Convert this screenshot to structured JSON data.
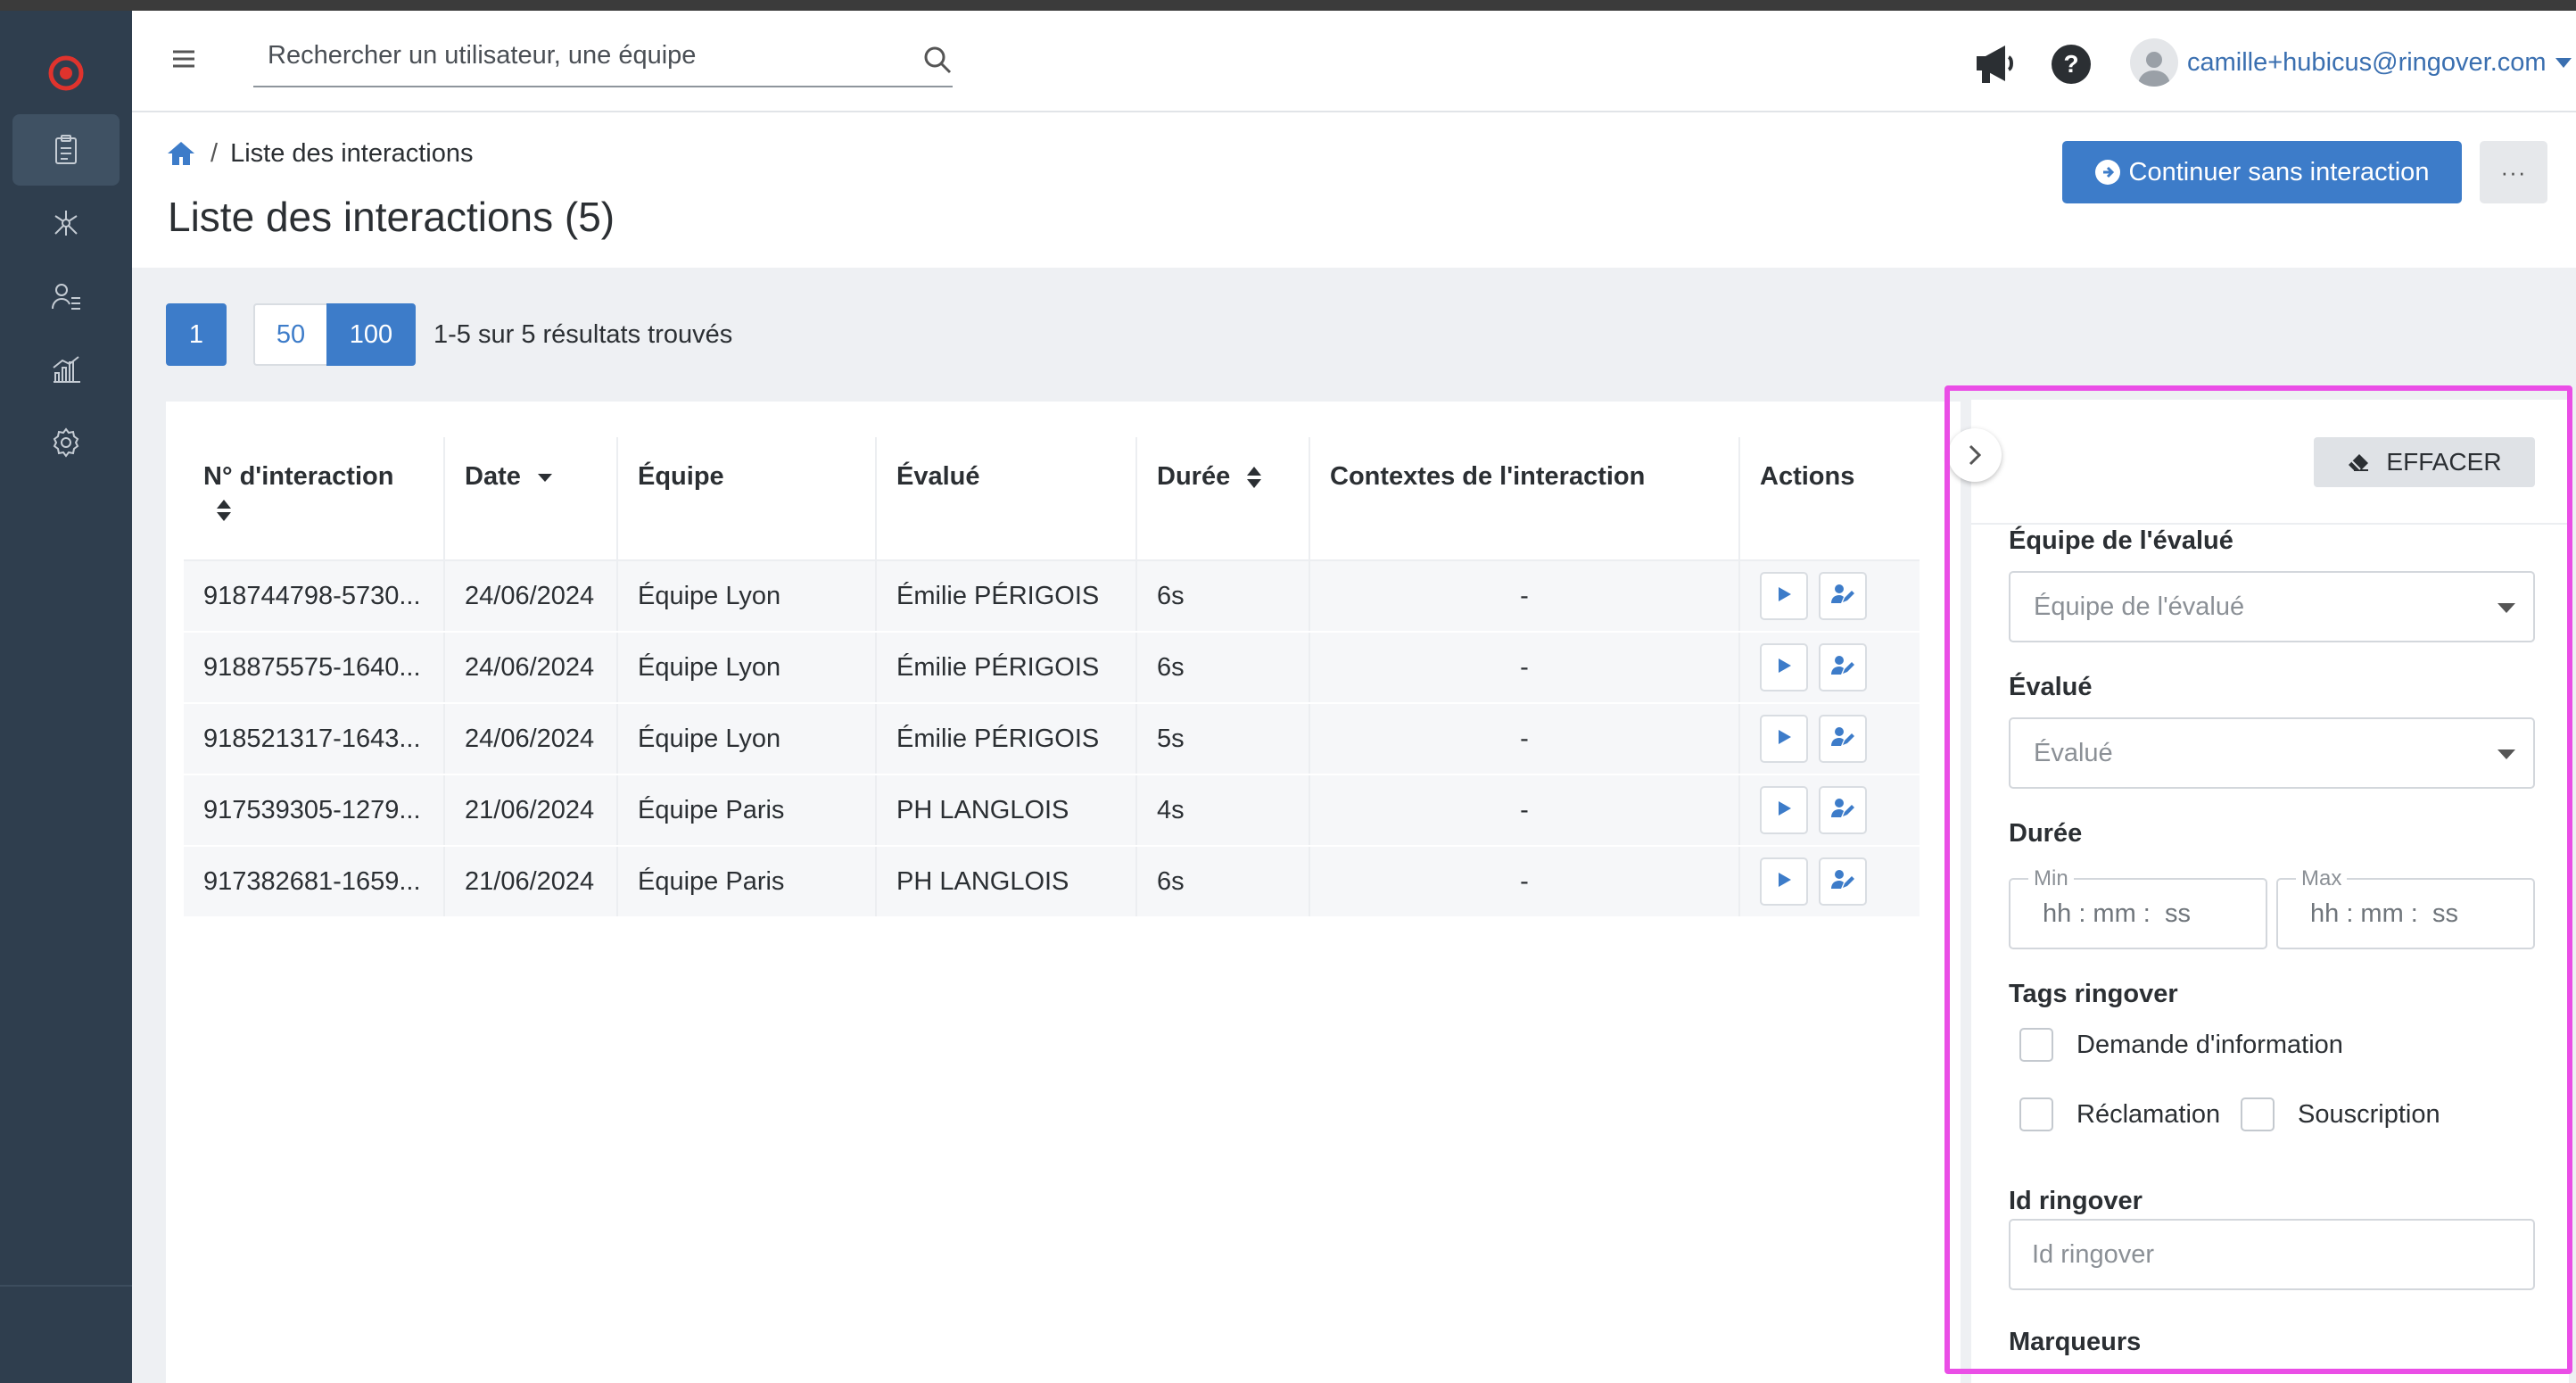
{
  "header": {
    "search_placeholder": "Rechercher un utilisateur, une équipe",
    "user_email": "camille+hubicus@ringover.com"
  },
  "breadcrumb": {
    "current": "Liste des interactions"
  },
  "page": {
    "title": "Liste des interactions (5)",
    "continue_button": "Continuer sans interaction",
    "more_button": "···"
  },
  "pagination": {
    "current_page": "1",
    "size_50": "50",
    "size_100": "100",
    "results_text": "1-5 sur 5 résultats trouvés"
  },
  "table": {
    "columns": [
      "N° d'interaction",
      "Date",
      "Équipe",
      "Évalué",
      "Durée",
      "Contextes de l'interaction",
      "Actions"
    ],
    "rows": [
      {
        "id": "918744798-5730...",
        "date": "24/06/2024",
        "team": "Équipe Lyon",
        "evaluated": "Émilie PÉRIGOIS",
        "duration": "6s",
        "context": "-"
      },
      {
        "id": "918875575-1640...",
        "date": "24/06/2024",
        "team": "Équipe Lyon",
        "evaluated": "Émilie PÉRIGOIS",
        "duration": "6s",
        "context": "-"
      },
      {
        "id": "918521317-1643...",
        "date": "24/06/2024",
        "team": "Équipe Lyon",
        "evaluated": "Émilie PÉRIGOIS",
        "duration": "5s",
        "context": "-"
      },
      {
        "id": "917539305-1279...",
        "date": "21/06/2024",
        "team": "Équipe Paris",
        "evaluated": "PH LANGLOIS",
        "duration": "4s",
        "context": "-"
      },
      {
        "id": "917382681-1659...",
        "date": "21/06/2024",
        "team": "Équipe Paris",
        "evaluated": "PH LANGLOIS",
        "duration": "6s",
        "context": "-"
      }
    ]
  },
  "filters": {
    "clear_button": "EFFACER",
    "team_label": "Équipe de l'évalué",
    "team_placeholder": "Équipe de l'évalué",
    "evaluated_label": "Évalué",
    "evaluated_placeholder": "Évalué",
    "duration_label": "Durée",
    "min_label": "Min",
    "max_label": "Max",
    "time_placeholder": "hh : mm :  ss",
    "tags_label": "Tags ringover",
    "tags": [
      "Demande d'information",
      "Réclamation",
      "Souscription"
    ],
    "id_label": "Id ringover",
    "id_placeholder": "Id ringover",
    "markers_label": "Marqueurs"
  },
  "colors": {
    "primary": "#3d7cc9",
    "sidebar": "#2f3e4e",
    "highlight": "#ea4ee6"
  }
}
